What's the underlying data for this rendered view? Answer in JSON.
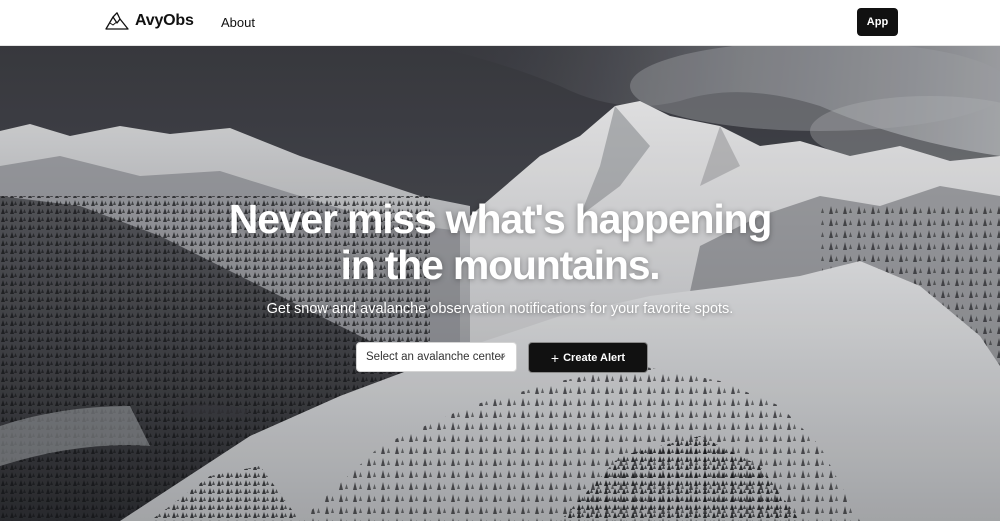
{
  "navbar": {
    "brand_name": "AvyObs",
    "brand_icon": "mountain-logo-icon",
    "about_label": "About",
    "app_button_label": "App"
  },
  "hero": {
    "headline_line1": "Never miss what's happening",
    "headline_line2": "in the mountains.",
    "subheadline": "Get snow and avalanche observation notifications for your favorite spots.",
    "select_placeholder": "Select an avalanche center",
    "create_alert_label": "Create Alert",
    "create_alert_icon": "plus-icon",
    "background": "snowy-mountain-range-photo"
  },
  "colors": {
    "text_dark": "#111111",
    "button_dark": "#111111",
    "white": "#ffffff"
  }
}
